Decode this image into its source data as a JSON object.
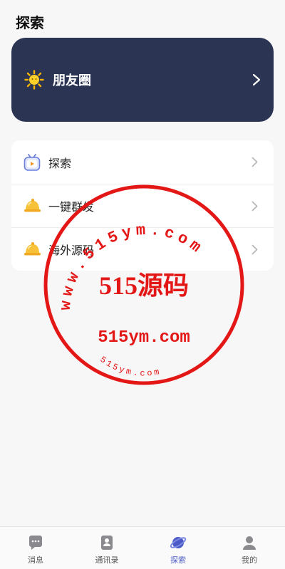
{
  "header": {
    "title": "探索"
  },
  "moments": {
    "label": "朋友圈"
  },
  "list": {
    "items": [
      {
        "label": "探索"
      },
      {
        "label": "一键群发"
      },
      {
        "label": "海外源码"
      }
    ]
  },
  "tabbar": {
    "tabs": [
      {
        "label": "消息"
      },
      {
        "label": "通讯录"
      },
      {
        "label": "探索"
      },
      {
        "label": "我的"
      }
    ],
    "active_color": "#4a59c7"
  },
  "watermark": {
    "main": "515源码",
    "domain": "515ym.com",
    "arc_top": "www.515ym.com",
    "arc_bottom": "515ym.com"
  }
}
